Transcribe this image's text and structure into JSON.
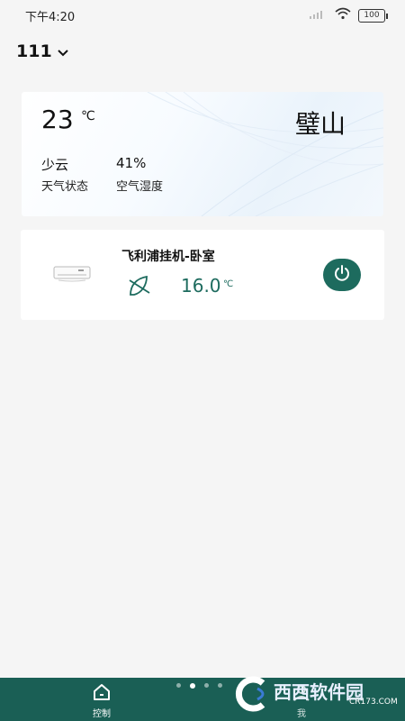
{
  "status_bar": {
    "time": "下午4:20",
    "signal": "...",
    "battery": "100"
  },
  "header": {
    "home_name": "111"
  },
  "weather": {
    "temperature": "23",
    "unit": "℃",
    "city": "璧山",
    "condition": "少云",
    "condition_label": "天气状态",
    "humidity": "41%",
    "humidity_label": "空气湿度"
  },
  "device": {
    "name": "飞利浦挂机-卧室",
    "set_temperature": "16.0",
    "unit": "℃",
    "power_icon": "power-icon",
    "ac_icon": "air-conditioner-icon",
    "mode_icon": "fan-mode-icon"
  },
  "bottom_nav": {
    "tabs": [
      {
        "label": "控制",
        "icon": "home-icon",
        "active": true
      },
      {
        "label": "我",
        "icon": "user-icon",
        "active": false
      }
    ],
    "page_dots": 4,
    "active_dot": 1
  },
  "watermark": {
    "brand": "西西软件园",
    "site": "CR173.COM"
  },
  "colors": {
    "accent": "#1d6b5e",
    "bottom_bar": "#1a5f55",
    "background": "#f5f5f5"
  }
}
